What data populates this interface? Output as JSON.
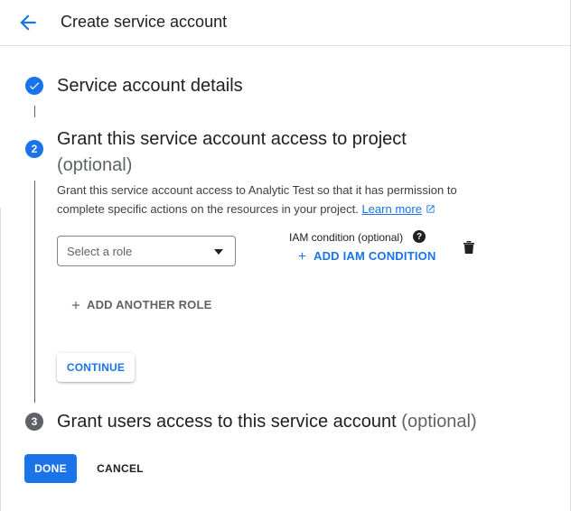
{
  "header": {
    "title": "Create service account"
  },
  "steps": [
    {
      "title": "Service account details"
    },
    {
      "number": "2",
      "title": "Grant this service account access to project",
      "optional": "(optional)",
      "description_prefix": "Grant this service account access to Analytic Test so that it has permission to complete specific actions on the resources in your project. ",
      "learn_more": "Learn more"
    },
    {
      "number": "3",
      "title": "Grant users access to this service account",
      "optional": "(optional)"
    }
  ],
  "role_select": {
    "placeholder": "Select a role"
  },
  "iam": {
    "label": "IAM condition (optional)",
    "help_icon": "?",
    "add_label": "ADD IAM CONDITION"
  },
  "add_role_label": "ADD ANOTHER ROLE",
  "buttons": {
    "continue": "CONTINUE",
    "done": "DONE",
    "cancel": "CANCEL"
  },
  "colors": {
    "accent": "#1a73e8",
    "muted": "#5f6368"
  }
}
